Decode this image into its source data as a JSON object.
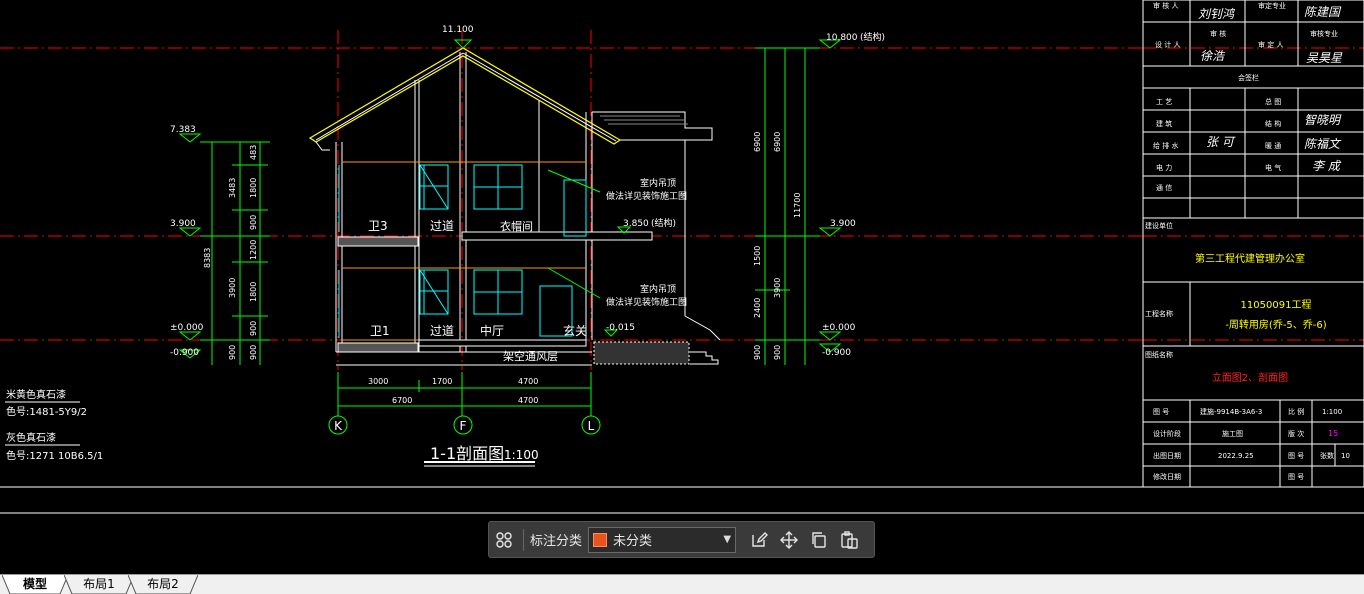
{
  "drawing": {
    "section_title": "1-1剖面图",
    "section_scale": "1:100",
    "axis_labels": [
      "K",
      "F",
      "L"
    ],
    "dims_row1": [
      "3000",
      "1700",
      "4700"
    ],
    "dims_row2": [
      "6700",
      "4700"
    ],
    "elevations": {
      "ridge": "11.100",
      "top_struct": "10.800",
      "struct_note": "(结构)",
      "left_top": "7.383",
      "second_floor_left": "3.900",
      "second_floor_right": "3.900",
      "balcony": "3.850",
      "ground_left": "±0.000",
      "ground_right": "±0.000",
      "minus_left": "-0.900",
      "minus_right": "-0.900",
      "entry": "-0.015"
    },
    "left_dims": [
      "3483",
      "8383",
      "3900",
      "900",
      "900",
      "1200",
      "1800",
      "900",
      "1800",
      "900",
      "900",
      "483"
    ],
    "right_dims": [
      "6900",
      "6900",
      "11700",
      "3900",
      "1500",
      "2400",
      "900",
      "900"
    ],
    "rooms": {
      "wc2": "卫3",
      "pass2": "过道",
      "closet": "衣帽间",
      "wc1": "卫1",
      "pass1": "过道",
      "hall": "中厅",
      "entrance": "玄关",
      "crawl": "架空通风层"
    },
    "notes": {
      "upper1": "室内吊顶",
      "upper2": "做法详见装饰施工图",
      "lower1": "室内吊顶",
      "lower2": "做法详见装饰施工图"
    },
    "legend": {
      "stone1_name": "米黄色真石漆",
      "stone1_code": "色号:1481-5Y9/2",
      "stone2_name": "灰色真石漆",
      "stone2_code": "色号:1271 10B6.5/1"
    }
  },
  "titleblock": {
    "rows_top": [
      "审 核 人",
      "审定专业",
      "设 计 人",
      "审 核",
      "审 定 人",
      "审核专业",
      "会签栏"
    ],
    "sign_top": [
      "刘钊鸿",
      "陈建国",
      "徐浩",
      "吴昊星"
    ],
    "disciplines": [
      "工 艺",
      "总 图",
      "建 筑",
      "结 构",
      "给 排 水",
      "暖 通",
      "电 力",
      "电 气",
      "通 信"
    ],
    "disc_signs": [
      "智晓明",
      "张 可",
      "陈福文",
      "李 成"
    ],
    "labels": {
      "design_unit": "建设单位",
      "project_name": "工程名称",
      "drawing_name": "图纸名称",
      "drawing_no": "图 号",
      "scale": "比 例",
      "stage": "设计阶段",
      "version": "版 次",
      "date": "出图日期",
      "sheets": "张数",
      "revision": "修改日期",
      "sheet_no": "图 号"
    },
    "values": {
      "design_unit": "第三工程代建管理办公室",
      "project_line1": "11050091工程",
      "project_line2": "-周转用房(乔-5、乔-6)",
      "drawing_name": "立面图2、剖面图",
      "drawing_no": "建施-9914B-3A6-3",
      "scale": "1:100",
      "stage": "施工图",
      "version": "15",
      "date": "2022.9.25",
      "sheets_label": "张数",
      "sheets": "10"
    }
  },
  "toolbar": {
    "label": "标注分类",
    "select_value": "未分类",
    "swatch_color": "#e8531e",
    "icons": [
      "grid-icon",
      "edit-icon",
      "move-icon",
      "copy-icon",
      "paste-icon"
    ]
  },
  "tabs": [
    "模型",
    "布局1",
    "布局2"
  ],
  "colors": {
    "red_axis": "#ff0000",
    "green": "#00ff00",
    "yellow": "#ffff00",
    "cyan": "#00ffff",
    "white": "#ffffff",
    "magenta": "#ff00ff"
  }
}
